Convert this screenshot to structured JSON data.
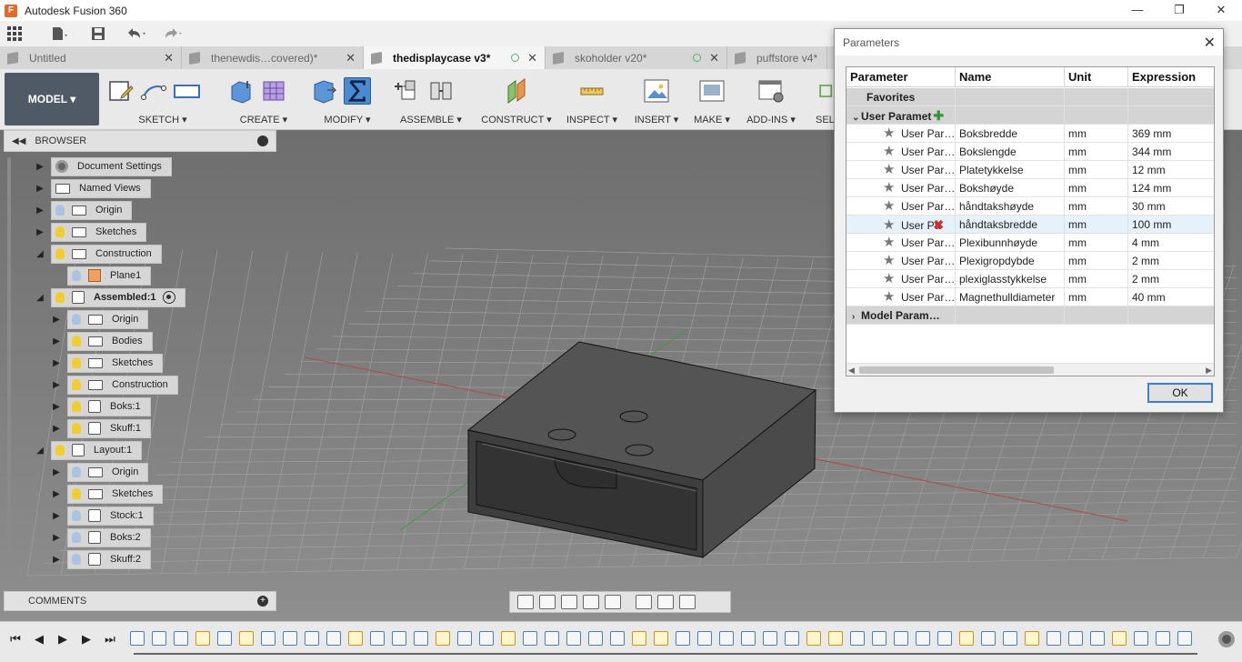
{
  "window": {
    "title": "Autodesk Fusion 360",
    "logo_letter": "F",
    "controls": [
      "—",
      "❐",
      "✕"
    ]
  },
  "quick_access": {
    "icons": [
      "apps-grid-icon",
      "file-icon",
      "save-icon",
      "undo-icon",
      "redo-icon"
    ]
  },
  "tabs": [
    {
      "label": "Untitled",
      "active": false
    },
    {
      "label": "thenewdis…covered)*",
      "active": false
    },
    {
      "label": "thedisplaycase v3*",
      "active": true
    },
    {
      "label": "skoholder v20*",
      "active": false
    },
    {
      "label": "puffstore v4*",
      "active": false
    }
  ],
  "ribbon": {
    "workspace": "MODEL ▾",
    "groups": [
      {
        "label": "SKETCH ▾"
      },
      {
        "label": "CREATE ▾"
      },
      {
        "label": "MODIFY ▾"
      },
      {
        "label": "ASSEMBLE ▾"
      },
      {
        "label": "CONSTRUCT ▾"
      },
      {
        "label": "INSPECT ▾"
      },
      {
        "label": "INSERT ▾"
      },
      {
        "label": "MAKE ▾"
      },
      {
        "label": "ADD-INS ▾"
      },
      {
        "label": "SELI"
      }
    ]
  },
  "browser": {
    "title": "BROWSER",
    "nodes": [
      {
        "label": "Document Settings"
      },
      {
        "label": "Named Views"
      },
      {
        "label": "Origin"
      },
      {
        "label": "Sketches"
      },
      {
        "label": "Construction"
      },
      {
        "label": "Plane1"
      },
      {
        "label": "Assembled:1"
      },
      {
        "label": "Origin"
      },
      {
        "label": "Bodies"
      },
      {
        "label": "Sketches"
      },
      {
        "label": "Construction"
      },
      {
        "label": "Boks:1"
      },
      {
        "label": "Skuff:1"
      },
      {
        "label": "Layout:1"
      },
      {
        "label": "Origin"
      },
      {
        "label": "Sketches"
      },
      {
        "label": "Stock:1"
      },
      {
        "label": "Boks:2"
      },
      {
        "label": "Skuff:2"
      }
    ]
  },
  "comments": {
    "title": "COMMENTS"
  },
  "dialog": {
    "title": "Parameters",
    "columns": [
      "Parameter",
      "Name",
      "Unit",
      "Expression"
    ],
    "favorites_label": "Favorites",
    "user_group_label": "User Paramet",
    "model_group_label": "Model Param…",
    "rows": [
      {
        "param": "User Par…",
        "name": "Boksbredde",
        "unit": "mm",
        "expr": "369 mm"
      },
      {
        "param": "User Par…",
        "name": "Bokslengde",
        "unit": "mm",
        "expr": "344 mm"
      },
      {
        "param": "User Par…",
        "name": "Platetykkelse",
        "unit": "mm",
        "expr": "12 mm"
      },
      {
        "param": "User Par…",
        "name": "Bokshøyde",
        "unit": "mm",
        "expr": "124 mm"
      },
      {
        "param": "User Par…",
        "name": "håndtakshøyde",
        "unit": "mm",
        "expr": "30 mm"
      },
      {
        "param": "User Pa",
        "name": "håndtaksbredde",
        "unit": "mm",
        "expr": "100 mm"
      },
      {
        "param": "User Par…",
        "name": "Plexibunnhøyde",
        "unit": "mm",
        "expr": "4 mm"
      },
      {
        "param": "User Par…",
        "name": "Plexigropdybde",
        "unit": "mm",
        "expr": "2 mm"
      },
      {
        "param": "User Par…",
        "name": "plexiglasstykkelse",
        "unit": "mm",
        "expr": "2 mm"
      },
      {
        "param": "User Par…",
        "name": "Magnethulldiameter",
        "unit": "mm",
        "expr": "40 mm"
      }
    ],
    "ok_label": "OK"
  },
  "colors": {
    "accent": "#3c7fd4",
    "model_button": "#505a66",
    "bulb_on": "#f2cd2b",
    "bulb_off": "#aac3e2"
  }
}
